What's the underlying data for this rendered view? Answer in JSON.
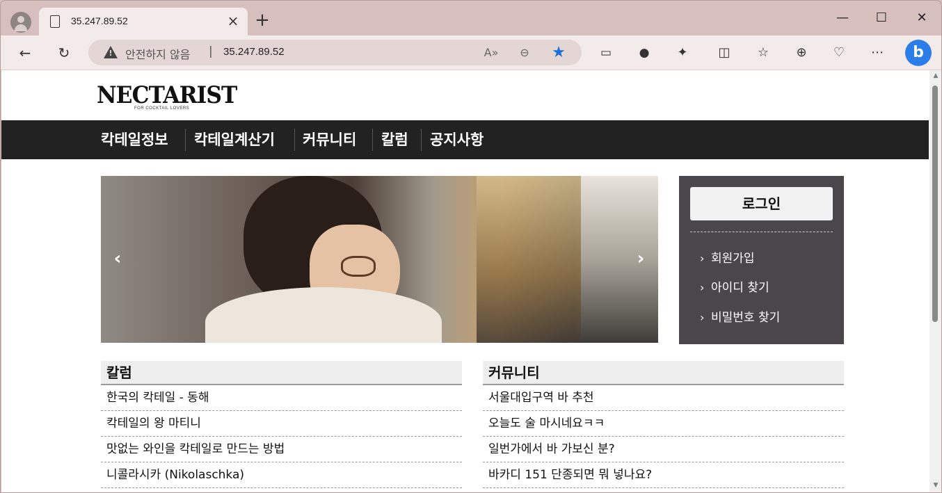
{
  "browser": {
    "tab_title": "35.247.89.52",
    "new_tab": "+",
    "close_tab": "×",
    "window_controls": {
      "minimize": "—",
      "maximize": "☐",
      "close": "✕"
    },
    "security_label": "안전하지 않음",
    "separator": "|",
    "url": "35.247.89.52",
    "icons": [
      "back-icon",
      "refresh-icon",
      "read-aloud-icon",
      "zoom-out-icon",
      "favorite-star-icon",
      "sidebar-icon",
      "extension-icon",
      "puzzle-icon",
      "split-screen-icon",
      "favorites-icon",
      "collections-icon",
      "health-icon",
      "more-icon",
      "bing-icon"
    ]
  },
  "site": {
    "logo": "NECTARIST",
    "logo_sub": "FOR COCKTAIL LOVERS",
    "nav": [
      "칵테일정보",
      "칵테일계산기",
      "커뮤니티",
      "칼럼",
      "공지사항"
    ]
  },
  "login": {
    "button": "로그인",
    "links": [
      "회원가입",
      "아이디 찾기",
      "비밀번호 찾기"
    ]
  },
  "boards": {
    "column": {
      "title": "칼럼",
      "items": [
        "한국의 칵테일 - 동해",
        "칵테일의 왕 마티니",
        "맛없는 와인을 칵테일로 만드는 방법",
        "니콜라시카 (Nikolaschka)"
      ]
    },
    "community": {
      "title": "커뮤니티",
      "items": [
        "서울대입구역 바 추천",
        "오늘도 술 마시네요ㅋㅋ",
        "일번가에서 바 가보신 분?",
        "바카디 151 단종되면 뭐 넣나요?"
      ]
    }
  },
  "colors": {
    "nav_bg": "#222222",
    "login_bg": "#49474b",
    "accent_star": "#1a6fd6",
    "frame": "#d6bfbd"
  }
}
